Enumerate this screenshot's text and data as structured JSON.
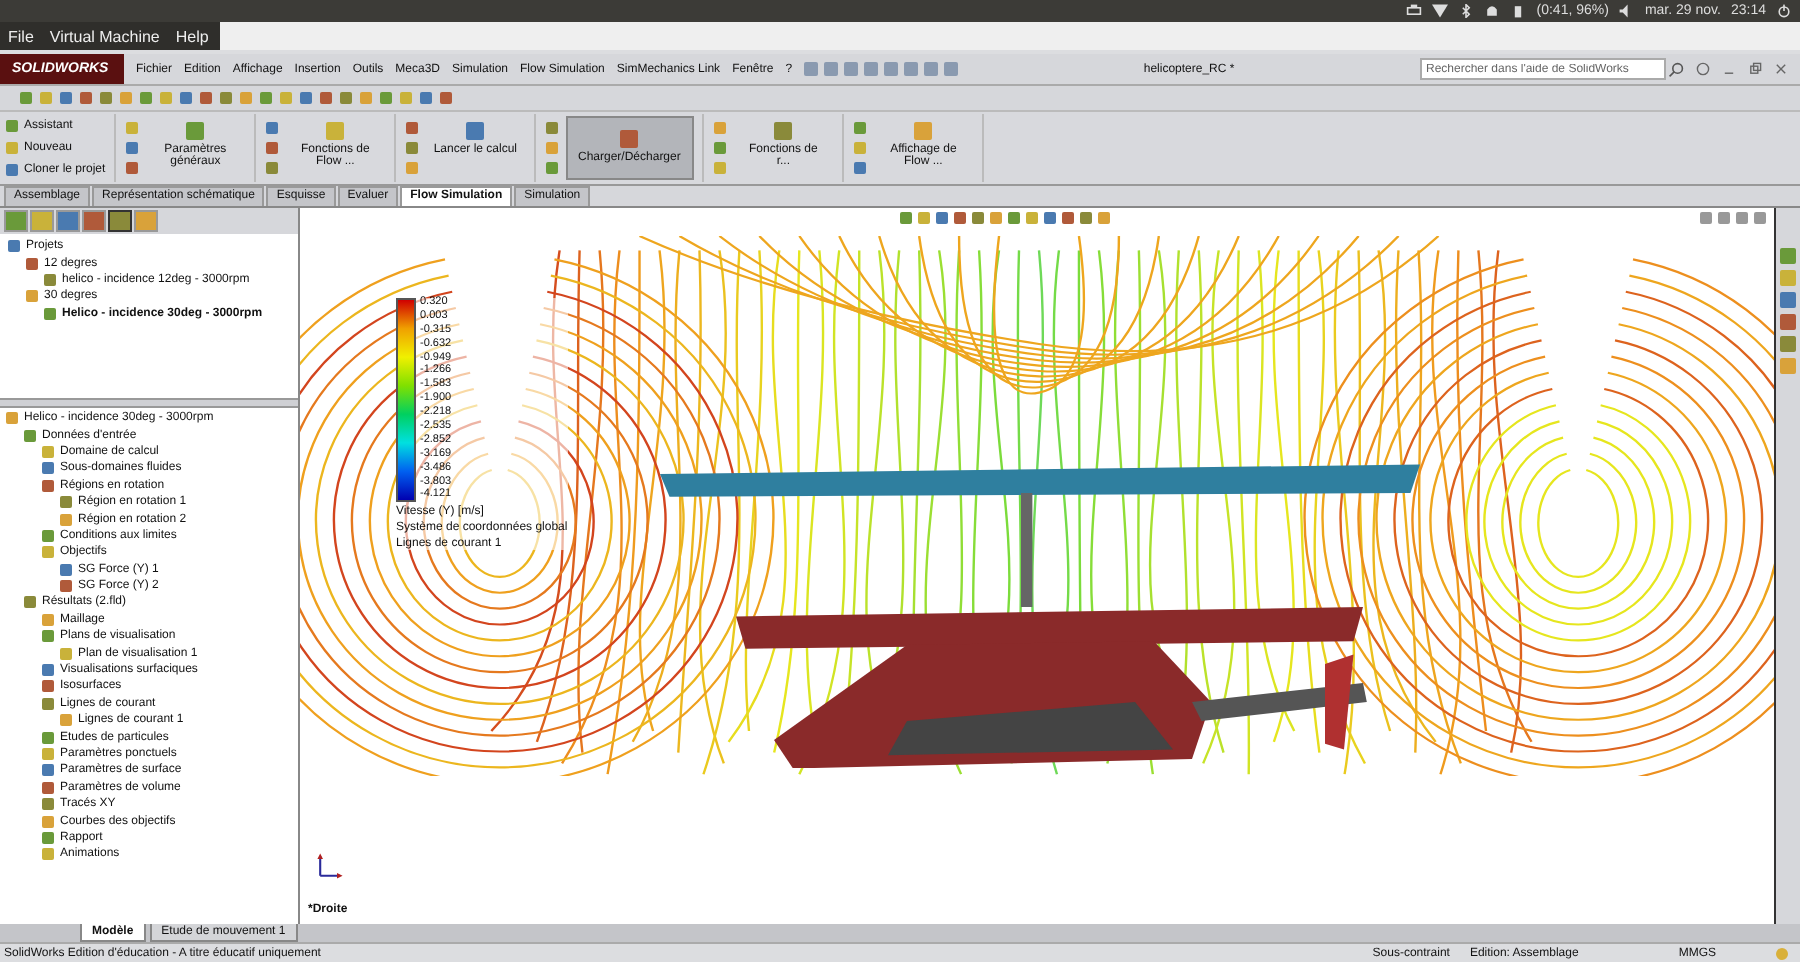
{
  "system_bar": {
    "battery": "(0:41, 96%)",
    "date": "mar. 29 nov.",
    "time": "23:14"
  },
  "vm_menu": [
    "File",
    "Virtual Machine",
    "Help"
  ],
  "app": {
    "logo": "SOLIDWORKS",
    "menu": [
      "Fichier",
      "Edition",
      "Affichage",
      "Insertion",
      "Outils",
      "Meca3D",
      "Simulation",
      "Flow Simulation",
      "SimMechanics Link",
      "Fenêtre",
      "?"
    ],
    "document_title": "helicoptere_RC *",
    "search": {
      "placeholder": "Rechercher dans l'aide de SolidWorks"
    }
  },
  "command_manager": [
    {
      "kind": "list",
      "items": [
        "Assistant",
        "Nouveau",
        "Cloner le projet"
      ]
    },
    {
      "kind": "large",
      "label": "Paramètres généraux",
      "selected": false
    },
    {
      "kind": "large",
      "label": "Fonctions de Flow ...",
      "selected": false
    },
    {
      "kind": "large",
      "label": "Lancer le calcul",
      "selected": false
    },
    {
      "kind": "large",
      "label": "Charger/Décharger",
      "selected": true
    },
    {
      "kind": "large",
      "label": "Fonctions de r...",
      "selected": false
    },
    {
      "kind": "large",
      "label": "Affichage de Flow ...",
      "selected": false
    }
  ],
  "tabs": [
    {
      "label": "Assemblage",
      "selected": false
    },
    {
      "label": "Représentation schématique",
      "selected": false
    },
    {
      "label": "Esquisse",
      "selected": false
    },
    {
      "label": "Evaluer",
      "selected": false
    },
    {
      "label": "Flow Simulation",
      "selected": true
    },
    {
      "label": "Simulation",
      "selected": false
    }
  ],
  "projects": {
    "label": "Projets",
    "children": [
      {
        "label": "12 degres",
        "selected": false,
        "children": [
          {
            "label": "helico - incidence 12deg - 3000rpm",
            "selected": false
          }
        ]
      },
      {
        "label": "30 degres",
        "selected": false,
        "children": [
          {
            "label": "Helico - incidence 30deg - 3000rpm",
            "selected": true
          }
        ]
      }
    ]
  },
  "analysis_tree": {
    "label": "Helico - incidence 30deg - 3000rpm",
    "children": [
      {
        "label": "Données d'entrée",
        "children": [
          {
            "label": "Domaine de calcul"
          },
          {
            "label": "Sous-domaines fluides"
          },
          {
            "label": "Régions en rotation",
            "children": [
              {
                "label": "Région en rotation 1"
              },
              {
                "label": "Région en rotation 2"
              }
            ]
          },
          {
            "label": "Conditions aux limites"
          },
          {
            "label": "Objectifs",
            "children": [
              {
                "label": "SG Force (Y) 1"
              },
              {
                "label": "SG Force (Y) 2"
              }
            ]
          }
        ]
      },
      {
        "label": "Résultats (2.fld)",
        "children": [
          {
            "label": "Maillage"
          },
          {
            "label": "Plans de visualisation",
            "children": [
              {
                "label": "Plan de visualisation 1"
              }
            ]
          },
          {
            "label": "Visualisations surfaciques"
          },
          {
            "label": "Isosurfaces"
          },
          {
            "label": "Lignes de courant",
            "children": [
              {
                "label": "Lignes de courant 1"
              }
            ]
          },
          {
            "label": "Etudes de particules"
          },
          {
            "label": "Paramètres ponctuels"
          },
          {
            "label": "Paramètres de surface"
          },
          {
            "label": "Paramètres de volume"
          },
          {
            "label": "Tracés XY"
          },
          {
            "label": "Courbes des objectifs"
          },
          {
            "label": "Rapport"
          },
          {
            "label": "Animations"
          }
        ]
      }
    ]
  },
  "viewport": {
    "legend": {
      "values": [
        "0.320",
        "0.003",
        "-0.315",
        "-0.632",
        "-0.949",
        "-1.266",
        "-1.583",
        "-1.900",
        "-2.218",
        "-2.535",
        "-2.852",
        "-3.169",
        "-3.486",
        "-3.803",
        "-4.121"
      ],
      "quantity": "Vitesse (Y) [m/s]",
      "coordinates": "Système de coordonnées global",
      "plot": "Lignes de courant 1"
    },
    "view_label": "*Droite"
  },
  "bottom_tabs": [
    {
      "label": "Modèle",
      "selected": true
    },
    {
      "label": "Etude de mouvement 1",
      "selected": false
    }
  ],
  "status_bar": {
    "message": "SolidWorks Edition d'éducation - A titre éducatif uniquement",
    "constraint": "Sous-contraint",
    "mode": "Edition: Assemblage",
    "units": "MMGS"
  }
}
